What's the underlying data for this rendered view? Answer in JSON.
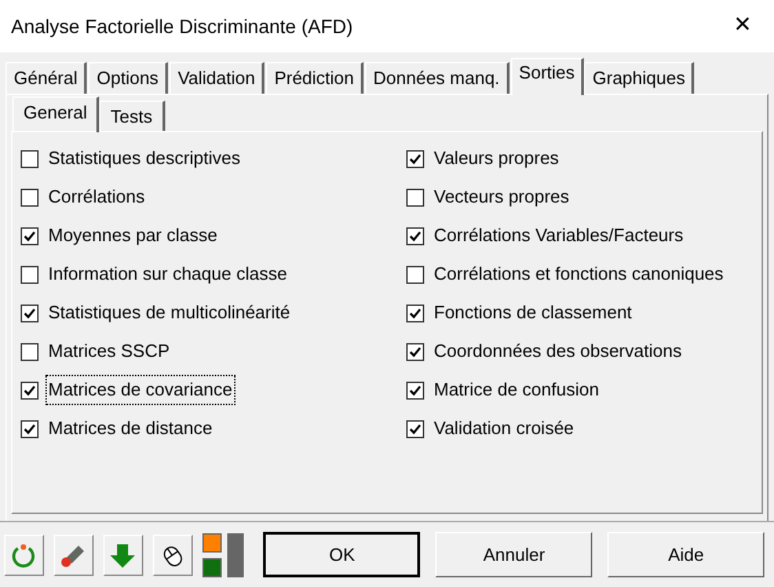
{
  "window": {
    "title": "Analyse Factorielle Discriminante (AFD)",
    "close": "✕"
  },
  "tabs": [
    {
      "label": "Général",
      "selected": false
    },
    {
      "label": "Options",
      "selected": false
    },
    {
      "label": "Validation",
      "selected": false
    },
    {
      "label": "Prédiction",
      "selected": false
    },
    {
      "label": "Données manq.",
      "selected": false
    },
    {
      "label": "Sorties",
      "selected": true
    },
    {
      "label": "Graphiques",
      "selected": false
    }
  ],
  "subtabs": [
    {
      "label": "General",
      "selected": true
    },
    {
      "label": "Tests",
      "selected": false
    }
  ],
  "options_left": [
    {
      "label": "Statistiques descriptives",
      "checked": false,
      "focused": false
    },
    {
      "label": "Corrélations",
      "checked": false,
      "focused": false
    },
    {
      "label": "Moyennes par classe",
      "checked": true,
      "focused": false
    },
    {
      "label": "Information sur chaque classe",
      "checked": false,
      "focused": false
    },
    {
      "label": "Statistiques de multicolinéarité",
      "checked": true,
      "focused": false
    },
    {
      "label": "Matrices SSCP",
      "checked": false,
      "focused": false
    },
    {
      "label": "Matrices de covariance",
      "checked": true,
      "focused": true
    },
    {
      "label": "Matrices de distance",
      "checked": true,
      "focused": false
    }
  ],
  "options_right": [
    {
      "label": "Valeurs propres",
      "checked": true,
      "focused": false
    },
    {
      "label": "Vecteurs propres",
      "checked": false,
      "focused": false
    },
    {
      "label": "Corrélations Variables/Facteurs",
      "checked": true,
      "focused": false
    },
    {
      "label": "Corrélations et fonctions canoniques",
      "checked": false,
      "focused": false
    },
    {
      "label": "Fonctions de classement",
      "checked": true,
      "focused": false
    },
    {
      "label": "Coordonnées des observations",
      "checked": true,
      "focused": false
    },
    {
      "label": "Matrice de confusion",
      "checked": true,
      "focused": false
    },
    {
      "label": "Validation croisée",
      "checked": true,
      "focused": false
    }
  ],
  "buttons": [
    {
      "label": "OK",
      "default": true
    },
    {
      "label": "Annuler",
      "default": false
    },
    {
      "label": "Aide",
      "default": false
    }
  ]
}
